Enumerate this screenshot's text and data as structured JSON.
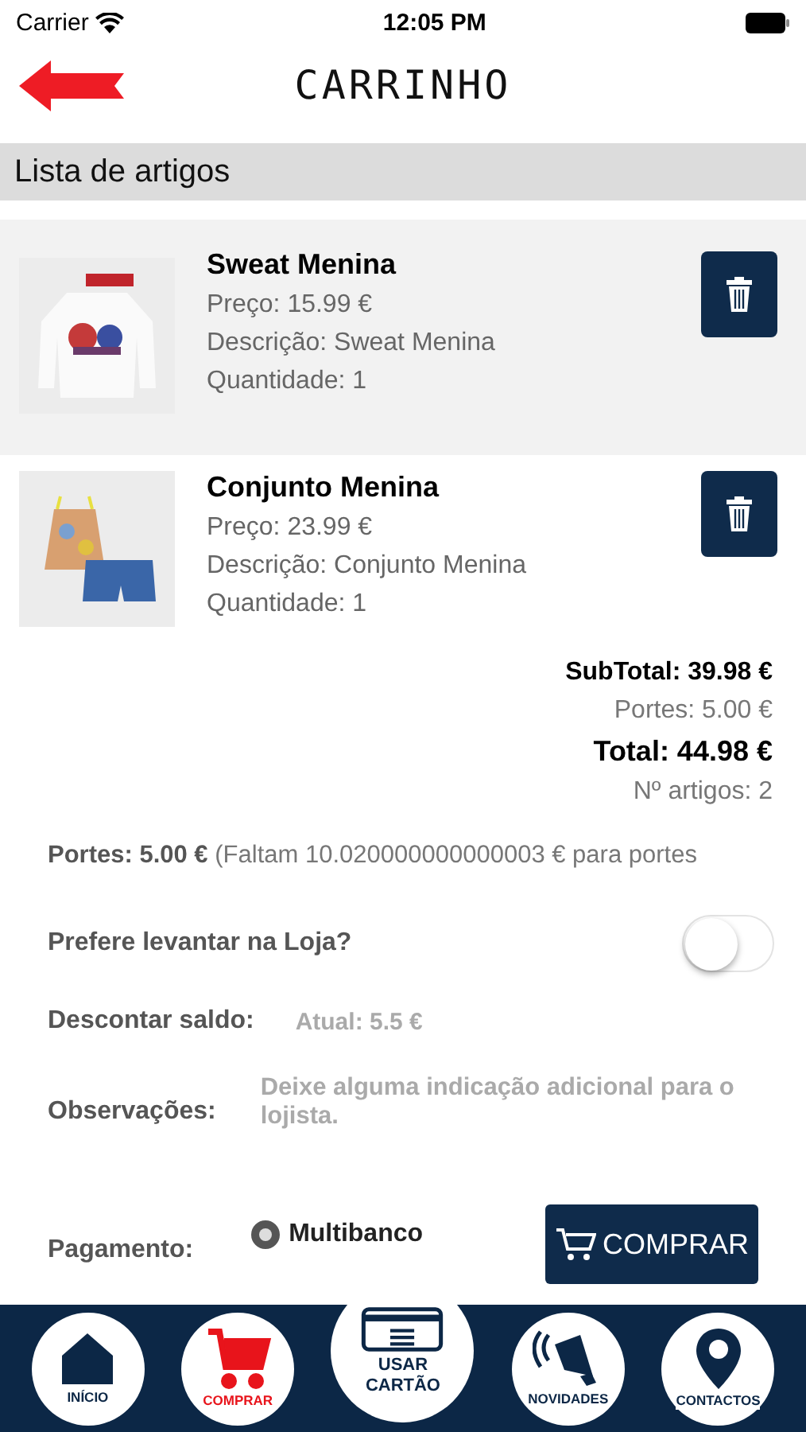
{
  "status_bar": {
    "carrier": "Carrier",
    "time": "12:05 PM"
  },
  "header": {
    "title": "CARRINHO"
  },
  "section_title": "Lista de artigos",
  "items": [
    {
      "name": "Sweat Menina",
      "price": "Preço: 15.99 €",
      "description": "Descrição: Sweat Menina",
      "quantity": "Quantidade: 1",
      "selected": true,
      "kind": "sweat"
    },
    {
      "name": "Conjunto Menina",
      "price": "Preço: 23.99 €",
      "description": "Descrição: Conjunto Menina",
      "quantity": "Quantidade: 1",
      "selected": false,
      "kind": "set"
    }
  ],
  "totals": {
    "subtotal": "SubTotal: 39.98 €",
    "shipping": "Portes: 5.00 €",
    "total": "Total: 44.98 €",
    "count": "Nº artigos: 2"
  },
  "shipping_note": "**Portes: 5.00 €** (Faltam 10.020000000000003 € para portes",
  "pickup": {
    "label": "Prefere levantar na Loja?",
    "on": false
  },
  "balance": {
    "label": "Descontar saldo:",
    "value": "Atual: 5.5 €"
  },
  "notes": {
    "label": "Observações:",
    "placeholder": "Deixe alguma indicação adicional para o lojista."
  },
  "payment": {
    "label": "Pagamento:",
    "option": "Multibanco",
    "selected": true,
    "button": "COMPRAR"
  },
  "nav": [
    {
      "kind": "home",
      "label": "INÍCIO",
      "selected": false
    },
    {
      "kind": "cart",
      "label": "COMPRAR",
      "selected": true
    },
    {
      "kind": "card",
      "label": "USAR CARTÃO",
      "selected": false
    },
    {
      "kind": "megaphone",
      "label": "NOVIDADES",
      "selected": false
    },
    {
      "kind": "pin",
      "label": "CONTACTOS",
      "selected": false
    }
  ]
}
